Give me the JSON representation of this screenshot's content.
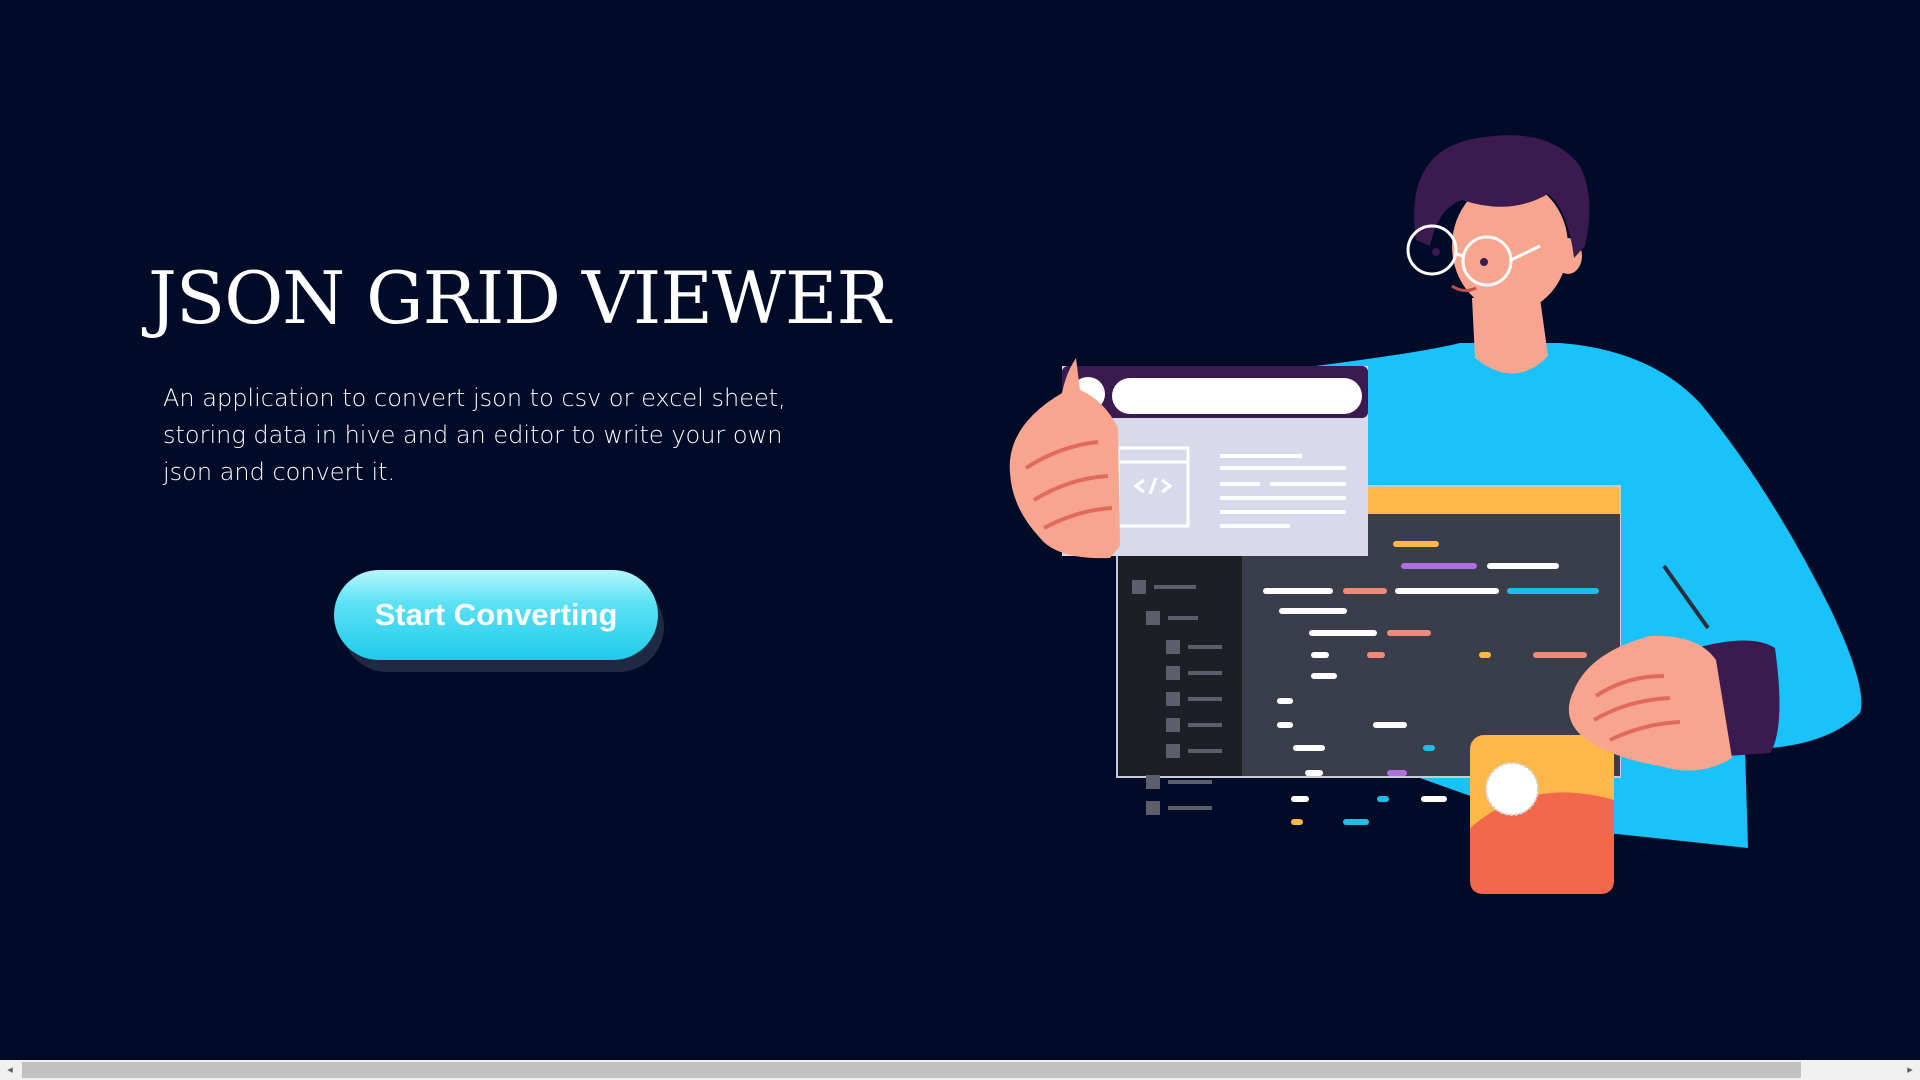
{
  "hero": {
    "title": "JSON GRID VIEWER",
    "description": "An application to convert json to csv or excel sheet, storing data in hive and an editor to write your own json and convert it.",
    "cta_label": "Start Converting"
  },
  "illustration": {
    "subject": "developer holding code editor window illustration",
    "icon": "code-brackets-icon"
  },
  "scrollbar": {
    "left_arrow": "◂",
    "right_arrow": "▸"
  },
  "colors": {
    "background": "#000b27",
    "accent": "#1fcbea",
    "shirt": "#19c3f9",
    "skin": "#f8a58f",
    "hair": "#3b1a4f",
    "editor_dark": "#2c2f3a",
    "orange": "#ffb74a",
    "coral": "#f2684c"
  }
}
